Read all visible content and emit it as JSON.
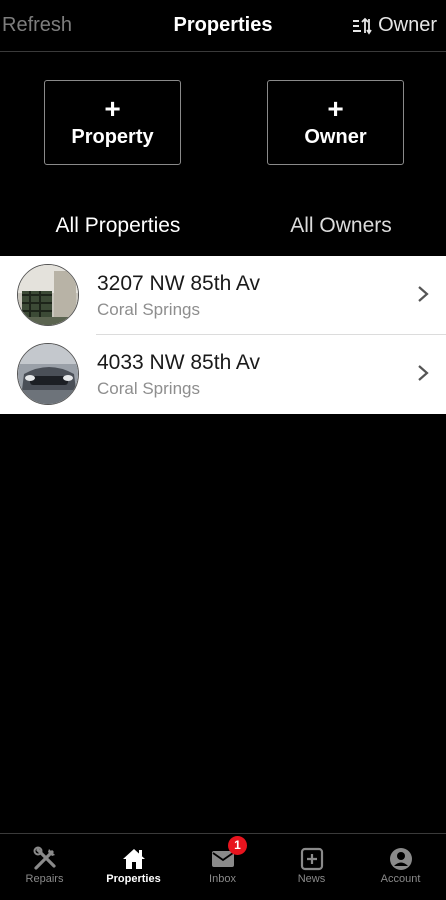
{
  "nav": {
    "left_label": "Refresh",
    "title": "Properties",
    "right_label": "Owner",
    "right_icon": "sort-icon"
  },
  "actions": {
    "add_property": {
      "plus": "+",
      "label": "Property"
    },
    "add_owner": {
      "plus": "+",
      "label": "Owner"
    }
  },
  "segments": {
    "left": "All Properties",
    "right": "All Owners"
  },
  "properties": [
    {
      "address": "3207 NW 85th Av",
      "city": "Coral Springs",
      "thumb": "house-photo"
    },
    {
      "address": "4033 NW 85th Av",
      "city": "Coral Springs",
      "thumb": "car-photo"
    }
  ],
  "tabbar": {
    "items": [
      {
        "label": "Repairs",
        "icon": "tools-icon"
      },
      {
        "label": "Properties",
        "icon": "home-icon",
        "active": true
      },
      {
        "label": "Inbox",
        "icon": "mail-icon",
        "badge": "1"
      },
      {
        "label": "News",
        "icon": "plus-square-icon"
      },
      {
        "label": "Account",
        "icon": "account-icon"
      }
    ]
  },
  "colors": {
    "background": "#000000",
    "list_background": "#ffffff",
    "badge": "#e8141e",
    "muted": "#8a8a8a"
  }
}
